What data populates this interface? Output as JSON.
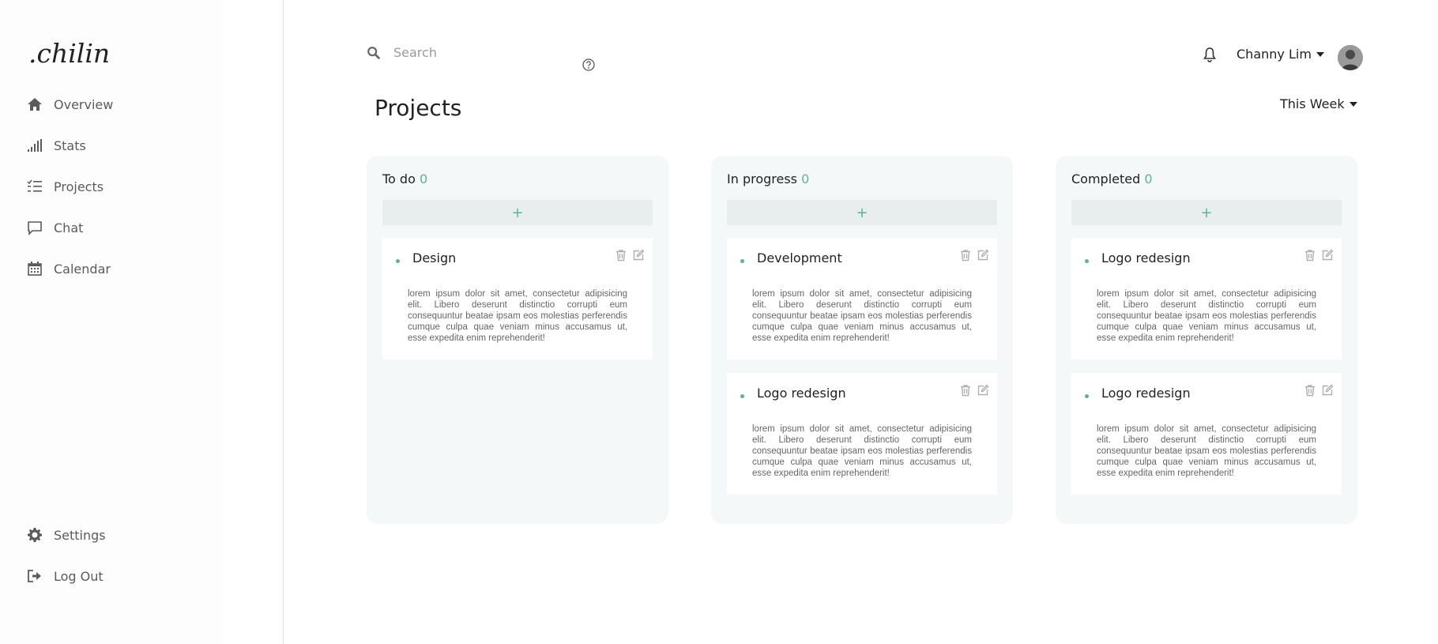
{
  "brand": {
    "logo_text": ".chilin"
  },
  "sidebar": {
    "items": [
      {
        "label": "Overview",
        "icon": "home-icon"
      },
      {
        "label": "Stats",
        "icon": "bar-chart-icon"
      },
      {
        "label": "Projects",
        "icon": "task-list-icon"
      },
      {
        "label": "Chat",
        "icon": "chat-bubble-icon"
      },
      {
        "label": "Calendar",
        "icon": "calendar-icon"
      }
    ],
    "bottom_items": [
      {
        "label": "Settings",
        "icon": "gear-icon"
      },
      {
        "label": "Log Out",
        "icon": "logout-icon"
      }
    ]
  },
  "header": {
    "search_placeholder": "Search",
    "user_name": "Channy Lim"
  },
  "page": {
    "title": "Projects",
    "period_filter": "This Week"
  },
  "columns": [
    {
      "title": "To do",
      "count": "0",
      "add_label": "+",
      "cards": [
        {
          "title": "Design",
          "description": "lorem ipsum dolor sit amet, consectetur adipisicing elit. Libero deserunt distinctio corrupti eum consequuntur beatae ipsam eos molestias perferendis cumque culpa quae veniam minus accusamus ut, esse expedita enim reprehenderit!"
        }
      ]
    },
    {
      "title": "In progress",
      "count": "0",
      "add_label": "+",
      "cards": [
        {
          "title": "Development",
          "description": "lorem ipsum dolor sit amet, consectetur adipisicing elit. Libero deserunt distinctio corrupti eum consequuntur beatae ipsam eos molestias perferendis cumque culpa quae veniam minus accusamus ut, esse expedita enim reprehenderit!"
        },
        {
          "title": "Logo redesign",
          "description": "lorem ipsum dolor sit amet, consectetur adipisicing elit. Libero deserunt distinctio corrupti eum consequuntur beatae ipsam eos molestias perferendis cumque culpa quae veniam minus accusamus ut, esse expedita enim reprehenderit!"
        }
      ]
    },
    {
      "title": "Completed",
      "count": "0",
      "add_label": "+",
      "cards": [
        {
          "title": "Logo redesign",
          "description": "lorem ipsum dolor sit amet, consectetur adipisicing elit. Libero deserunt distinctio corrupti eum consequuntur beatae ipsam eos molestias perferendis cumque culpa quae veniam minus accusamus ut, esse expedita enim reprehenderit!"
        },
        {
          "title": "Logo redesign",
          "description": "lorem ipsum dolor sit amet, consectetur adipisicing elit. Libero deserunt distinctio corrupti eum consequuntur beatae ipsam eos molestias perferendis cumque culpa quae veniam minus accusamus ut, esse expedita enim reprehenderit!"
        }
      ]
    }
  ],
  "colors": {
    "accent": "#5bb591",
    "column_bg": "#f4f8f8",
    "add_bg": "#e8eeee"
  }
}
